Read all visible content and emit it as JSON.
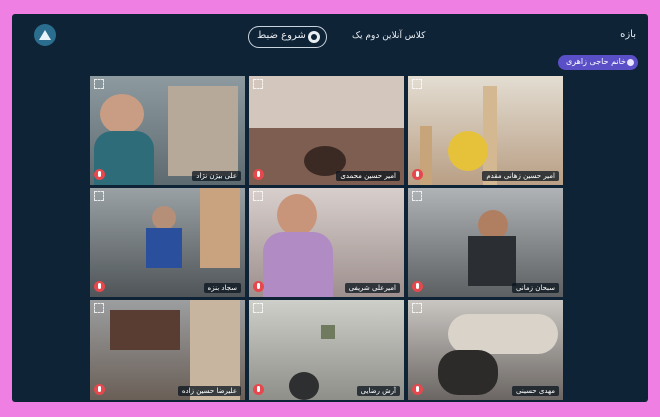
{
  "header": {
    "back_label": "بازه",
    "class_title": "کلاس آنلاین دوم یک",
    "record_label": "شروع ضبط"
  },
  "host_badge": "خانم حاجی زاهری",
  "tiles": [
    {
      "name": "علی بیژن نژاد"
    },
    {
      "name": "امیر حسین محمدی"
    },
    {
      "name": "امیر حسین زهانی مقدم"
    },
    {
      "name": "سجاد بنزه"
    },
    {
      "name": "امیرعلی شریفی"
    },
    {
      "name": "سبحان زمانی"
    },
    {
      "name": "علیرضا حسین زاده"
    },
    {
      "name": "آرش رضایی"
    },
    {
      "name": "مهدی حسینی"
    }
  ],
  "colors": {
    "background": "#ef7fe3",
    "panel": "#0f2336",
    "host_badge": "#5a4fc7",
    "mic_muted": "#e5484d"
  },
  "icons": [
    "logo-icon",
    "record-icon",
    "fullscreen-icon",
    "mic-off-icon"
  ]
}
